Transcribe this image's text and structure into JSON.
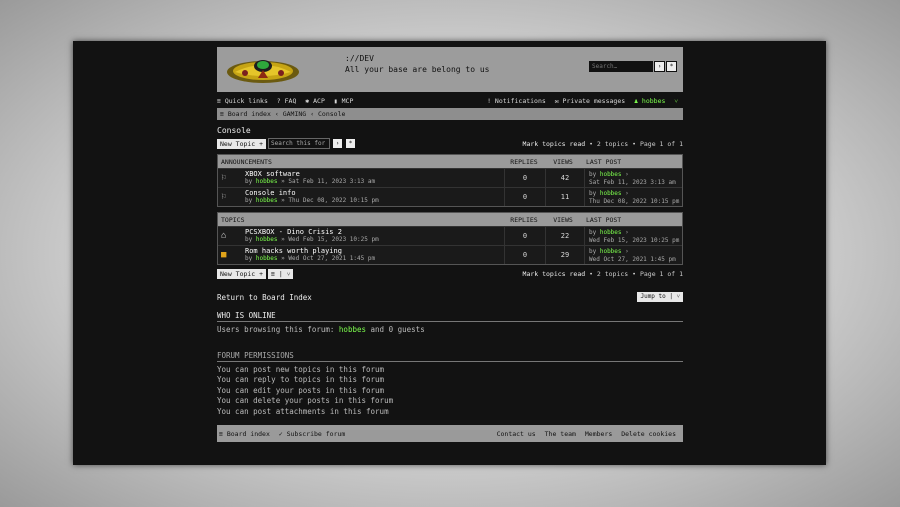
{
  "header": {
    "site_title": "://DEV",
    "site_desc": "All your base are belong to us",
    "search_placeholder": "Search…",
    "search_go": "›",
    "search_adv": "*"
  },
  "nav": {
    "quick_links": "≡ Quick links",
    "faq": "? FAQ",
    "acp": "✱ ACP",
    "mcp": "▮ MCP",
    "notifications": "! Notifications",
    "pm": "✉ Private messages",
    "user": "hobbes"
  },
  "breadcrumbs": [
    "≡ Board index",
    "‹ GAMING",
    "‹ Console"
  ],
  "forum": {
    "title": "Console",
    "new_topic": "New Topic +",
    "search_placeholder": "Search this for",
    "mark_read": "Mark topics read",
    "topic_count": "• 2 topics • Page 1 of 1",
    "return": "Return to Board Index",
    "jump_to": "Jump to"
  },
  "announcements": {
    "header": "ANNOUNCEMENTS",
    "rows": [
      {
        "title": "XBOX software",
        "author": "hobbes",
        "date": "» Sat Feb 11, 2023 3:13 am",
        "replies": "0",
        "views": "42",
        "last_by": "hobbes",
        "last_date": "Sat Feb 11, 2023 3:13 am"
      },
      {
        "title": "Console info",
        "author": "hobbes",
        "date": "» Thu Dec 08, 2022 10:15 pm",
        "replies": "0",
        "views": "11",
        "last_by": "hobbes",
        "last_date": "Thu Dec 08, 2022 10:15 pm"
      }
    ]
  },
  "topics": {
    "header": "TOPICS",
    "rows": [
      {
        "title": "PCSXBOX - Dino Crisis 2",
        "author": "hobbes",
        "date": "» Wed Feb 15, 2023 10:25 pm",
        "replies": "0",
        "views": "22",
        "last_by": "hobbes",
        "last_date": "Wed Feb 15, 2023 10:25 pm"
      },
      {
        "title": "Rom hacks worth playing",
        "author": "hobbes",
        "date": "» Wed Oct 27, 2021 1:45 pm",
        "replies": "0",
        "views": "29",
        "last_by": "hobbes",
        "last_date": "Wed Oct 27, 2021 1:45 pm"
      }
    ]
  },
  "columns": {
    "replies": "REPLIES",
    "views": "VIEWS",
    "last_post": "LAST POST",
    "by": "by"
  },
  "online": {
    "header": "WHO IS ONLINE",
    "prefix": "Users browsing this forum:",
    "user": "hobbes",
    "suffix": "and 0 guests"
  },
  "permissions": {
    "header": "FORUM PERMISSIONS",
    "lines": [
      "You can post new topics in this forum",
      "You can reply to topics in this forum",
      "You can edit your posts in this forum",
      "You can delete your posts in this forum",
      "You can post attachments in this forum"
    ]
  },
  "footer": {
    "board_index": "≡ Board index",
    "subscribe": "✓ Subscribe forum",
    "contact": "Contact us",
    "team": "The team",
    "members": "Members",
    "delete_cookies": "Delete cookies"
  },
  "colors": {
    "accent_user": "#7dff4d",
    "bar_bg": "#9a9a9a",
    "screen_bg": "#121212"
  }
}
